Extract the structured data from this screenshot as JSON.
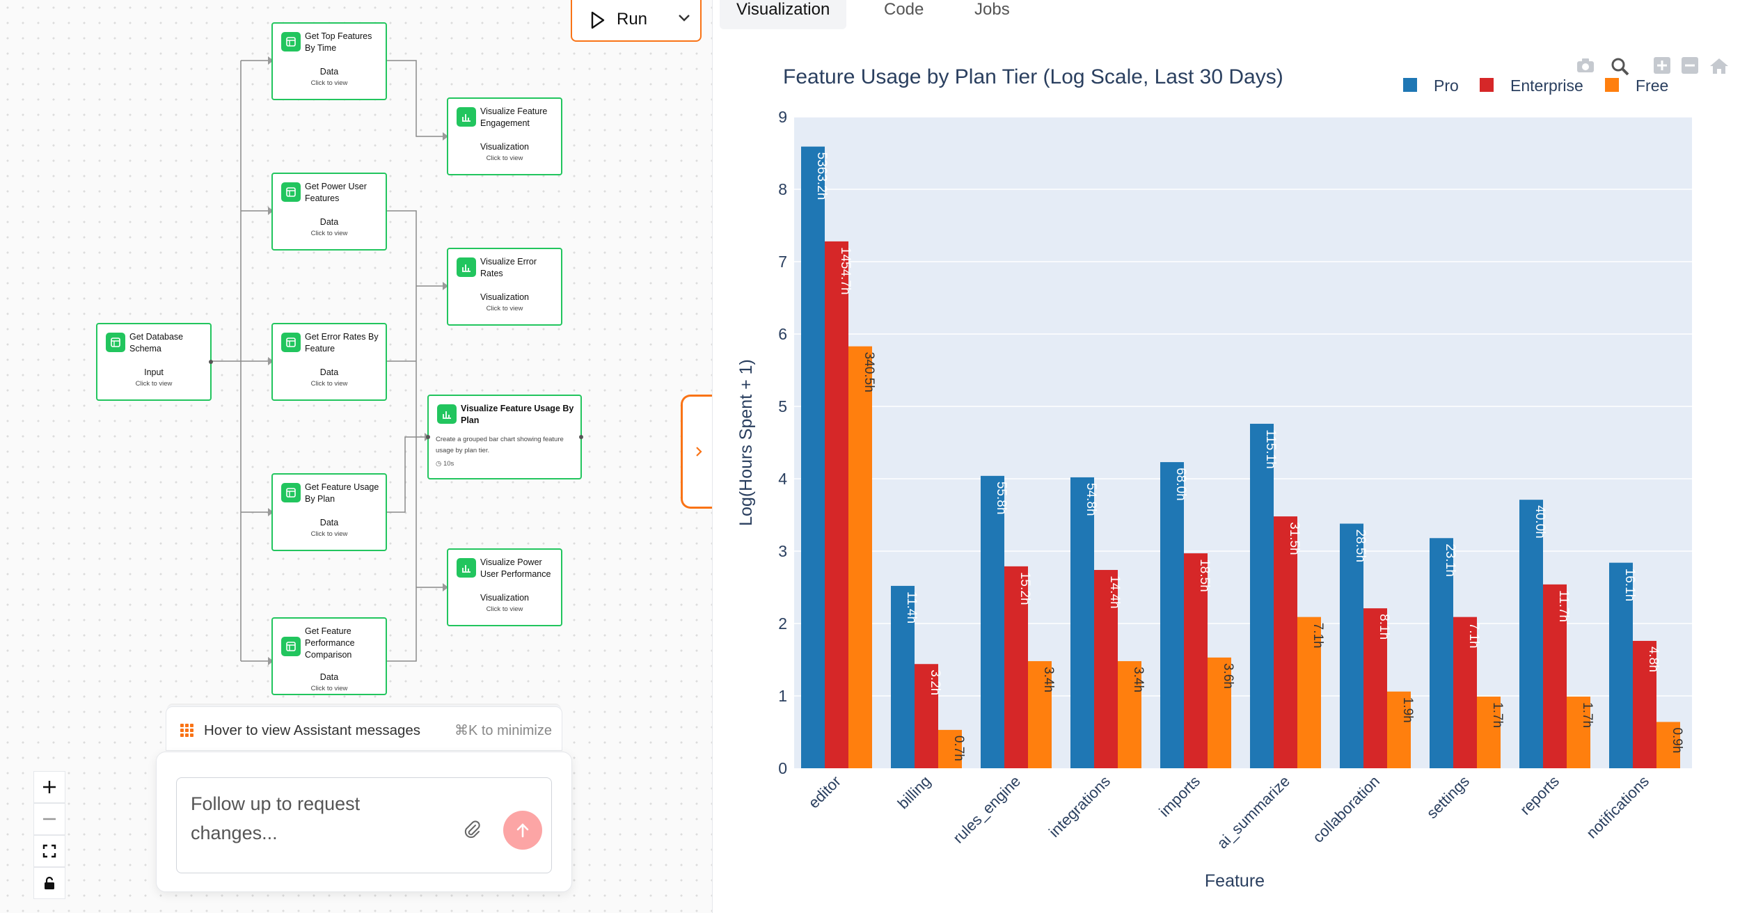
{
  "canvas": {
    "run_button": {
      "label": "Run"
    },
    "nodes": [
      {
        "id": "schema",
        "title": "Get Database Schema",
        "kind": "Input",
        "hint": "Click to view"
      },
      {
        "id": "top_time",
        "title": "Get Top Features By Time",
        "kind": "Data",
        "hint": "Click to view"
      },
      {
        "id": "power_user",
        "title": "Get Power User Features",
        "kind": "Data",
        "hint": "Click to view"
      },
      {
        "id": "error_rates",
        "title": "Get Error Rates By Feature",
        "kind": "Data",
        "hint": "Click to view"
      },
      {
        "id": "usage_plan",
        "title": "Get Feature Usage By Plan",
        "kind": "Data",
        "hint": "Click to view"
      },
      {
        "id": "perf_comp",
        "title": "Get Feature Performance Comparison",
        "kind": "Data",
        "hint": "Click to view"
      },
      {
        "id": "viz_engagement",
        "title": "Visualize Feature Engagement",
        "kind": "Visualization",
        "hint": "Click to view"
      },
      {
        "id": "viz_errors",
        "title": "Visualize Error Rates",
        "kind": "Visualization",
        "hint": "Click to view"
      },
      {
        "id": "viz_power",
        "title": "Visualize Power User Performance",
        "kind": "Visualization",
        "hint": "Click to view"
      }
    ],
    "selected_node": {
      "title": "Visualize Feature Usage By Plan",
      "description": "Create a grouped bar chart showing feature usage by plan tier.",
      "duration": "10s"
    },
    "assistant_bar": {
      "label": "Hover to view Assistant messages",
      "shortcut": "⌘K to minimize"
    },
    "chat": {
      "placeholder": "Follow up to request changes..."
    },
    "zoom_controls": [
      "zoom-in",
      "zoom-out",
      "fit-view",
      "lock"
    ]
  },
  "tabs": [
    {
      "label": "Visualization",
      "active": true
    },
    {
      "label": "Code",
      "active": false
    },
    {
      "label": "Jobs",
      "active": false
    }
  ],
  "modebar": [
    "camera-icon",
    "zoom-icon",
    "zoom-in-icon",
    "zoom-out-icon",
    "home-icon"
  ],
  "chart_data": {
    "type": "bar",
    "title": "Feature Usage by Plan Tier (Log Scale, Last 30 Days)",
    "xlabel": "Feature",
    "ylabel": "Log(Hours Spent + 1)",
    "ylim": [
      0,
      9
    ],
    "yticks": [
      0,
      1,
      2,
      3,
      4,
      5,
      6,
      7,
      8,
      9
    ],
    "grid": true,
    "legend_position": "top-right",
    "categories": [
      "editor",
      "billing",
      "rules_engine",
      "integrations",
      "imports",
      "ai_summarize",
      "collaboration",
      "settings",
      "reports",
      "notifications"
    ],
    "series": [
      {
        "name": "Pro",
        "color": "#1f77b4",
        "values": [
          8.59,
          2.52,
          4.04,
          4.02,
          4.23,
          4.76,
          3.38,
          3.18,
          3.71,
          2.84
        ],
        "labels": [
          "5363.2h",
          "11.4h",
          "55.8h",
          "54.8h",
          "68.0h",
          "115.1h",
          "28.5h",
          "23.1h",
          "40.0h",
          "16.1h"
        ]
      },
      {
        "name": "Enterprise",
        "color": "#d62728",
        "values": [
          7.28,
          1.44,
          2.79,
          2.74,
          2.97,
          3.48,
          2.21,
          2.09,
          2.54,
          1.76
        ],
        "labels": [
          "1454.7h",
          "3.2h",
          "15.2h",
          "14.4h",
          "18.5h",
          "31.5h",
          "8.1h",
          "7.1h",
          "11.7h",
          "4.8h"
        ]
      },
      {
        "name": "Free",
        "color": "#ff7f0e",
        "values": [
          5.83,
          0.53,
          1.48,
          1.48,
          1.53,
          2.09,
          1.06,
          0.99,
          0.99,
          0.64
        ],
        "labels": [
          "340.5h",
          "0.7h",
          "3.4h",
          "3.4h",
          "3.6h",
          "7.1h",
          "1.9h",
          "1.7h",
          "1.7h",
          "0.9h"
        ]
      }
    ]
  }
}
